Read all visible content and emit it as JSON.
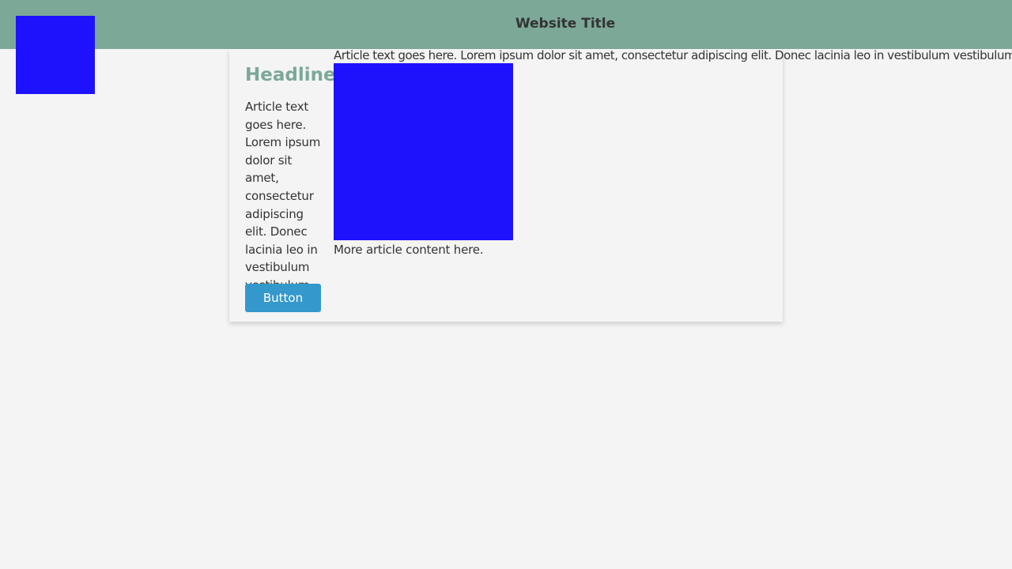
{
  "header": {
    "title": "Website Title",
    "background_color": "#7ca898"
  },
  "logo": {
    "color": "#1e12fc"
  },
  "card": {
    "headline": "Headline",
    "text": "Article text goes here. Lorem ipsum dolor sit amet, consectetur adipiscing elit. Donec lacinia leo in vestibulum vestibulum.",
    "button_label": "Button",
    "button_color": "#3498cc",
    "headline_color": "#7ca898"
  },
  "article": {
    "text": "Article text goes here. Lorem ipsum dolor sit amet, consectetur adipiscing elit. Donec lacinia leo in vestibulum vestibulum.",
    "image_color": "#1e12fc",
    "more_text": "More article content here."
  }
}
